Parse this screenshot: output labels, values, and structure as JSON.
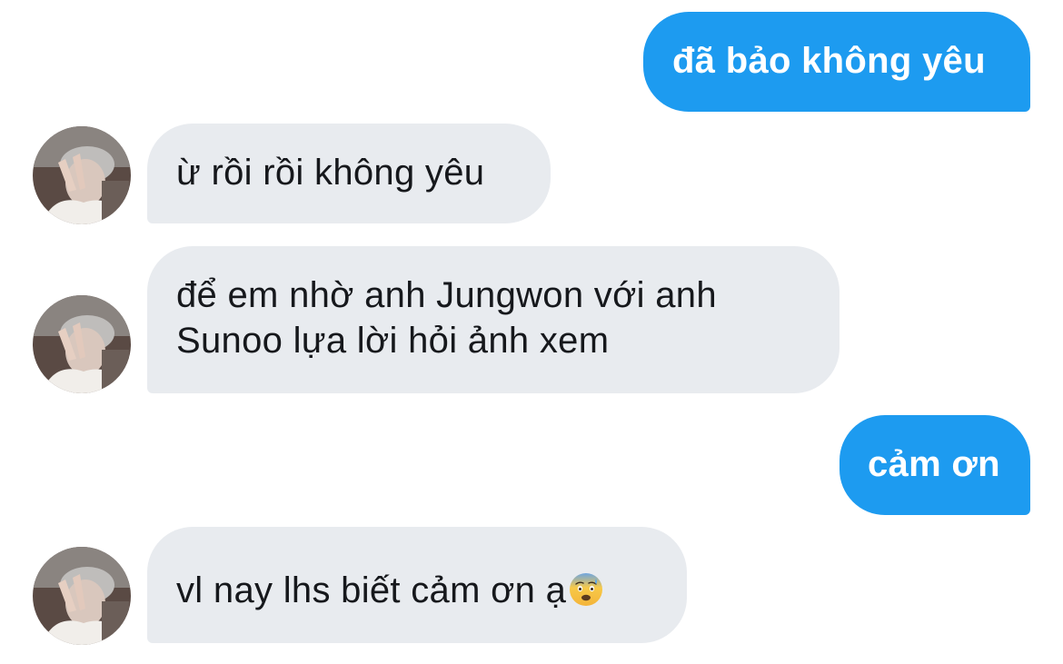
{
  "conversation": {
    "messages": [
      {
        "from": "me",
        "text": "đã bảo không yêu"
      },
      {
        "from": "other",
        "text": "ừ rồi rồi không yêu"
      },
      {
        "from": "other",
        "line1": "để em nhờ anh Jungwon với anh",
        "line2": "Sunoo lựa lời hỏi ảnh xem"
      },
      {
        "from": "me",
        "text": "cảm ơn"
      },
      {
        "from": "other",
        "text": "vl nay lhs biết cảm ơn ạ",
        "emoji": "anxious-face-with-sweat-icon"
      }
    ]
  },
  "colors": {
    "sent_bubble": "#1d9bf0",
    "received_bubble": "#e8ebef",
    "sent_text": "#ffffff",
    "received_text": "#16181c"
  },
  "avatar": {
    "icon": "user-avatar-photo"
  }
}
